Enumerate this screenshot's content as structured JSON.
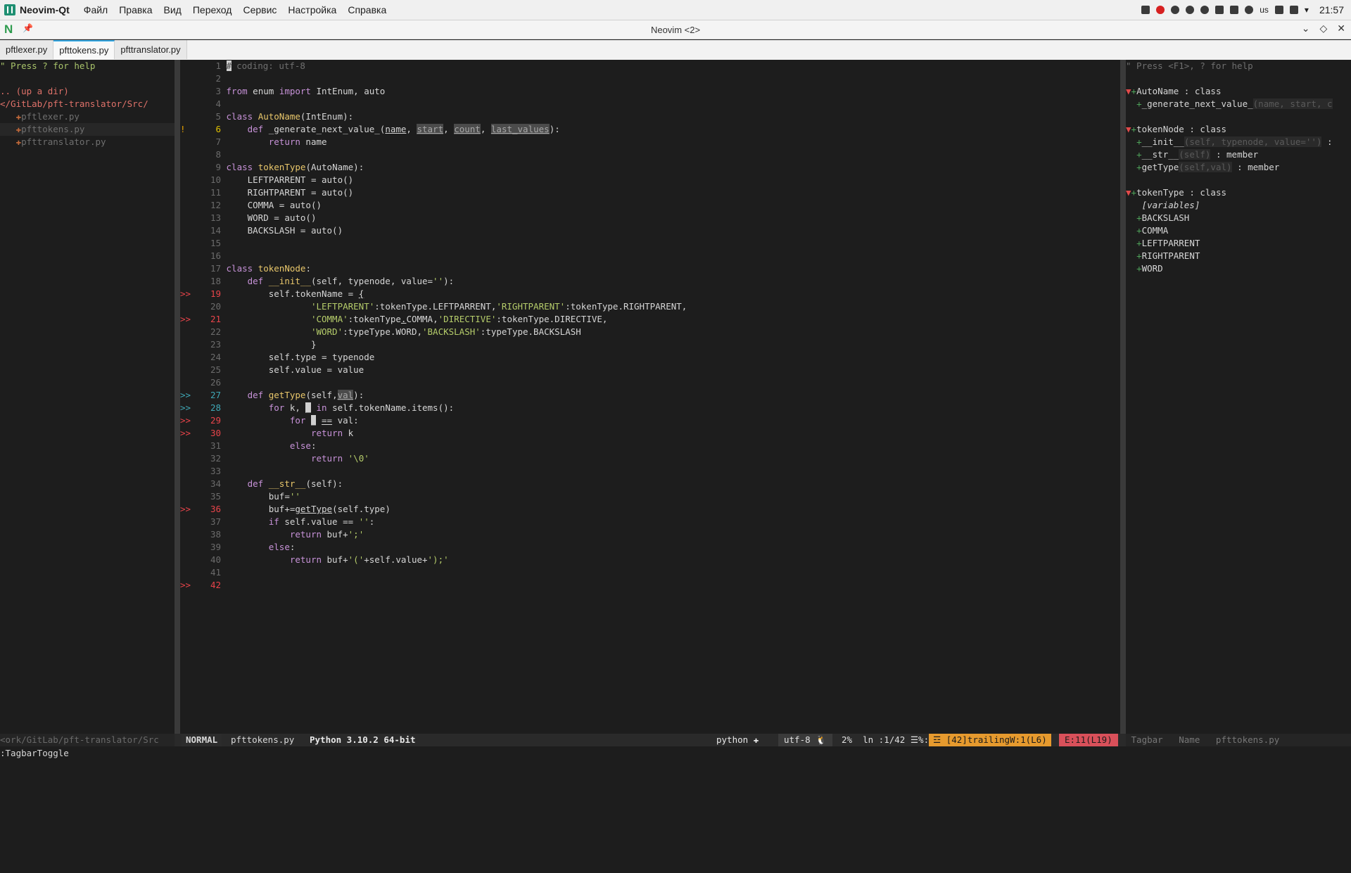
{
  "topbar": {
    "app_name": "Neovim-Qt",
    "menu": [
      "Файл",
      "Правка",
      "Вид",
      "Переход",
      "Сервис",
      "Настройка",
      "Справка"
    ],
    "kbd_layout": "us",
    "clock": "21:57"
  },
  "window": {
    "title": "Neovim <2>"
  },
  "tabs": [
    {
      "label": "pftlexer.py",
      "active": false
    },
    {
      "label": "pfttokens.py",
      "active": true
    },
    {
      "label": "pfttranslator.py",
      "active": false
    }
  ],
  "tree": {
    "help": "\" Press ? for help",
    "up_dir": ".. (up a dir)",
    "path": "</GitLab/pft-translator/Src/",
    "files": [
      "pftlexer.py",
      "pfttokens.py",
      "pfttranslator.py"
    ]
  },
  "tagbar": {
    "help": "\" Press <F1>, ? for help",
    "autoname_header": "AutoName : class",
    "autoname_member_name": "_generate_next_value_",
    "autoname_member_args": "(name, start, c",
    "tokennode_header": "tokenNode : class",
    "tokennode_members": [
      {
        "name": "__init__",
        "args": "(self, typenode, value='')",
        "kind": " :"
      },
      {
        "name": "__str__",
        "args": "(self)",
        "kind": " : member"
      },
      {
        "name": "getType",
        "args": "(self,val)",
        "kind": " : member"
      }
    ],
    "tokentype_header": "tokenType : class",
    "variables_label": "[variables]",
    "variables": [
      "BACKSLASH",
      "COMMA",
      "LEFTPARRENT",
      "RIGHTPARENT",
      "WORD"
    ]
  },
  "code": {
    "l1": "# coding: utf-8",
    "l3a": "from",
    "l3b": " enum ",
    "l3c": "import",
    "l3d": " IntEnum, auto",
    "l5a": "class",
    "l5b": " AutoName",
    "l5c": "(IntEnum):",
    "l6a": "    def",
    "l6b": " _generate_next_value_(",
    "l6c": "name",
    "l6d": ", ",
    "l6e": "start",
    "l6f": ", ",
    "l6g": "count",
    "l6h": ", ",
    "l6i": "last_values",
    "l6j": "):",
    "l7a": "        return",
    "l7b": " name",
    "l9a": "class",
    "l9b": " tokenType",
    "l9c": "(AutoName):",
    "l10": "    LEFTPARRENT = auto()",
    "l11": "    RIGHTPARENT = auto()",
    "l12": "    COMMA = auto()",
    "l13": "    WORD = auto()",
    "l14": "    BACKSLASH = auto()",
    "l17a": "class",
    "l17b": " tokenNode",
    "l17c": ":",
    "l18a": "    def",
    "l18b": " __init__",
    "l18c": "(self, typenode, value=",
    "l18d": "''",
    "l18e": "):",
    "l19a": "        self.tokenName = ",
    "l19b": "{",
    "l20a": "                ",
    "l20b": "'LEFTPARENT'",
    "l20c": ":tokenType.LEFTPARRENT,",
    "l20d": "'RIGHTPARENT'",
    "l20e": ":tokenType.RIGHTPARENT,",
    "l21a": "                ",
    "l21b": "'COMMA'",
    "l21c": ":tokenType",
    "l21d": ".",
    "l21e": "COMMA,",
    "l21f": "'DIRECTIVE'",
    "l21g": ":tokenType.DIRECTIVE,",
    "l22a": "                ",
    "l22b": "'WORD'",
    "l22c": ":typeType.WORD,",
    "l22d": "'BACKSLASH'",
    "l22e": ":typeType.BACKSLASH",
    "l23": "                }",
    "l24": "        self.type = typenode",
    "l25": "        self.value = value",
    "l27a": "    def",
    "l27b": " getType",
    "l27c": "(self,",
    "l27d": "val",
    "l27e": "):",
    "l28a": "        for",
    "l28b": " k, ",
    "l28c": "_",
    "l28d": " in",
    "l28e": " self.tokenName.items():",
    "l29a": "            for",
    "l29b": " ",
    "l29c": "_",
    "l29d": " ",
    "l29e": "==",
    "l29f": " val:",
    "l30a": "                return",
    "l30b": " k",
    "l31a": "            else",
    "l31b": ":",
    "l32a": "                return",
    "l32b": " ",
    "l32c": "'\\0'",
    "l34a": "    def",
    "l34b": " __str__",
    "l34c": "(self):",
    "l35a": "        buf=",
    "l35b": "''",
    "l36a": "        buf+=",
    "l36b": "getType",
    "l36c": "(self.type)",
    "l37a": "        if",
    "l37b": " self.value == ",
    "l37c": "''",
    "l37d": ":",
    "l38a": "            return",
    "l38b": " buf+",
    "l38c": "';'",
    "l39a": "        else",
    "l39b": ":",
    "l40a": "            return",
    "l40b": " buf+",
    "l40c": "'('",
    "l40d": "+self.value+",
    "l40e": "');'"
  },
  "signs": {
    "err": ">>",
    "warn": "!"
  },
  "status": {
    "cwd": "<ork/GitLab/pft-translator/Src",
    "mode": "NORMAL",
    "file": "pfttokens.py",
    "python": "Python 3.10.2 64-bit",
    "filetype": "python",
    "encoding": "utf-8",
    "position": "2%  ln :1/42 ☰%:1",
    "warnings": "☲ [42]trailingW:1(L6)",
    "errors": "E:11(L19)",
    "tagbar": " Tagbar   Name   pfttokens.py"
  },
  "cmdline": ":TagbarToggle"
}
